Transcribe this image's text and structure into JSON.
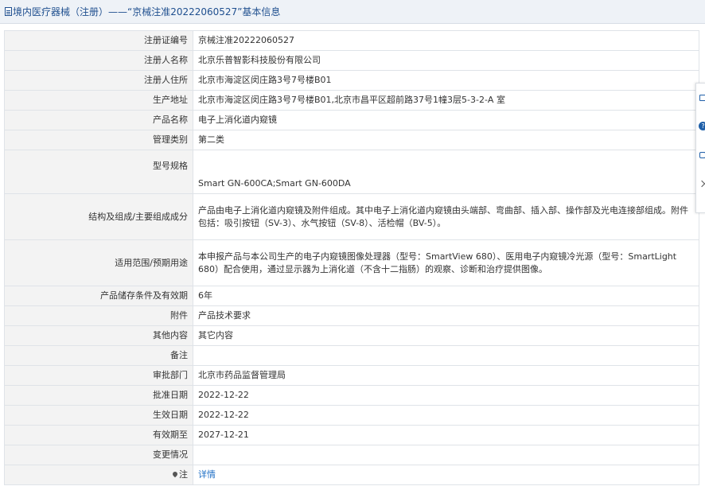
{
  "header": {
    "title": "境内医疗器械（注册）——“京械注准20222060527”基本信息"
  },
  "rows": [
    {
      "label": "注册证编号",
      "value": "京械注准20222060527"
    },
    {
      "label": "注册人名称",
      "value": "北京乐普智影科技股份有限公司"
    },
    {
      "label": "注册人住所",
      "value": "北京市海淀区闵庄路3号7号楼B01"
    },
    {
      "label": "生产地址",
      "value": "北京市海淀区闵庄路3号7号楼B01,北京市昌平区超前路37号1幢3层5-3-2-A 室"
    },
    {
      "label": "产品名称",
      "value": "电子上消化道内窥镜"
    },
    {
      "label": "管理类别",
      "value": "第二类"
    },
    {
      "label": "型号规格",
      "value": "Smart GN-600CA;Smart GN-600DA"
    },
    {
      "label": "结构及组成/主要组成成分",
      "value": "产品由电子上消化道内窥镜及附件组成。其中电子上消化道内窥镜由头端部、弯曲部、插入部、操作部及光电连接部组成。附件包括：吸引按钮（SV-3）、水气按钮（SV-8）、活检帽（BV-5）。"
    },
    {
      "label": "适用范围/预期用途",
      "value": "本申报产品与本公司生产的电子内窥镜图像处理器（型号：SmartView 680）、医用电子内窥镜冷光源（型号：SmartLight 680）配合使用，通过显示器为上消化道（不含十二指肠）的观察、诊断和治疗提供图像。"
    },
    {
      "label": "产品储存条件及有效期",
      "value": "6年"
    },
    {
      "label": "附件",
      "value": "产品技术要求"
    },
    {
      "label": "其他内容",
      "value": "其它内容"
    },
    {
      "label": "备注",
      "value": ""
    },
    {
      "label": "审批部门",
      "value": "北京市药品监督管理局"
    },
    {
      "label": "批准日期",
      "value": "2022-12-22"
    },
    {
      "label": "生效日期",
      "value": "2022-12-22"
    },
    {
      "label": "有效期至",
      "value": "2027-12-21"
    },
    {
      "label": "变更情况",
      "value": ""
    },
    {
      "label": "注",
      "value": "详情"
    }
  ],
  "icons": {
    "header_icon": "document-icon",
    "note_icon": "pin-icon",
    "toolbar": [
      "feedback-icon",
      "help-icon",
      "share-icon",
      "collapse-chevron-icon"
    ]
  },
  "colors": {
    "header_text": "#1f4f8f",
    "link": "#1f6fc5",
    "label_bg": "#f3f3f3",
    "border": "#dfe3e8"
  }
}
